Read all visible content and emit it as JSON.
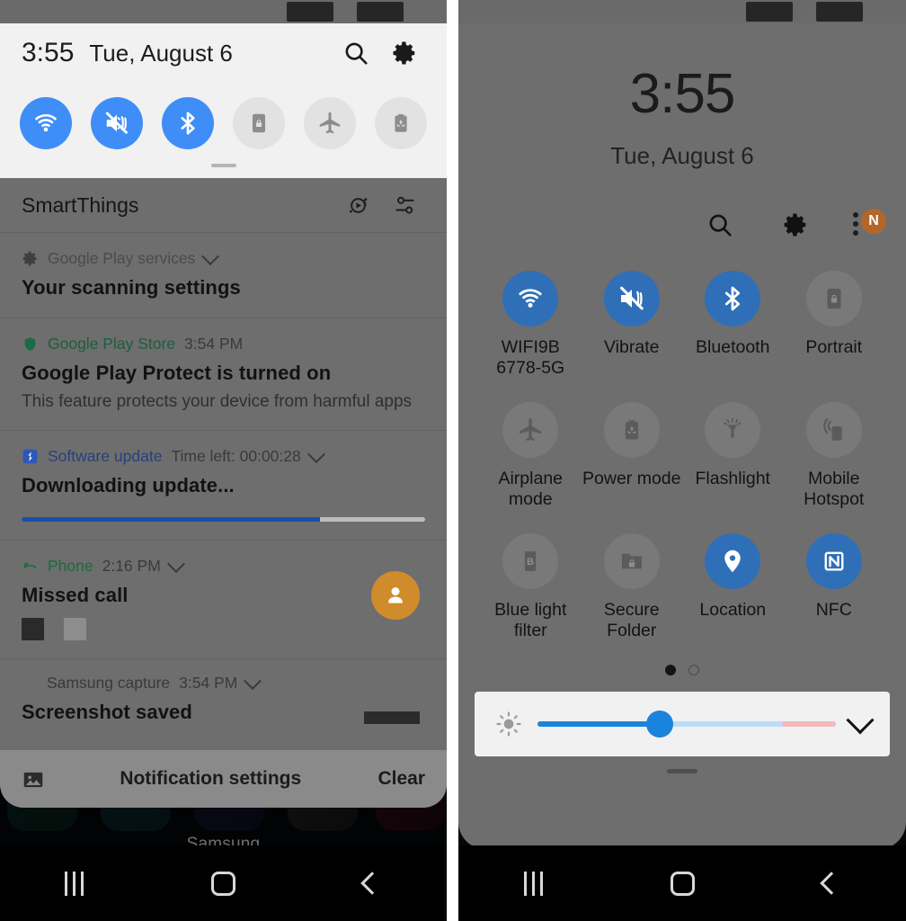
{
  "left_panel": {
    "statusbar": {
      "redacted_items": 2
    },
    "quick_panel": {
      "time": "3:55",
      "date": "Tue, August 6",
      "search_icon": "search-icon",
      "settings_icon": "gear-icon",
      "tiles": [
        {
          "name": "wifi-tile",
          "icon": "wifi-icon",
          "state": "on"
        },
        {
          "name": "vibrate-tile",
          "icon": "mute-vibrate-icon",
          "state": "on"
        },
        {
          "name": "bluetooth-tile",
          "icon": "bluetooth-icon",
          "state": "on"
        },
        {
          "name": "portrait-tile",
          "icon": "auto-rotate-lock-icon",
          "state": "off"
        },
        {
          "name": "airplane-mode-tile",
          "icon": "airplane-icon",
          "state": "off"
        },
        {
          "name": "power-mode-tile",
          "icon": "battery-recycle-icon",
          "state": "off"
        }
      ]
    },
    "notifications_header": {
      "title": "SmartThings",
      "icons": [
        "smartthings-scene-icon",
        "notification-filter-icon"
      ]
    },
    "notifications": [
      {
        "app": "Google Play services",
        "app_color": "#4b4b4b",
        "time": "",
        "title": "Your scanning settings",
        "body": "",
        "icon": "gear-icon",
        "has_chevron": true,
        "progress": null
      },
      {
        "app": "Google Play Store",
        "app_color": "#1b5e3f",
        "time": "3:54 PM",
        "title": "Google Play Protect is turned on",
        "body": "This feature protects your device from harmful apps",
        "icon": "shield-icon",
        "has_chevron": false,
        "progress": null
      },
      {
        "app": "Software update",
        "app_color": "#27407e",
        "time": "Time left: 00:00:28",
        "title": "Downloading update...",
        "body": "",
        "icon": "software-update-icon",
        "has_chevron": true,
        "progress": 74
      },
      {
        "app": "Phone",
        "app_color": "#1b6b3a",
        "time": "2:16 PM",
        "title": "Missed call",
        "body": "",
        "icon": "missed-call-icon",
        "has_chevron": true,
        "progress": null,
        "has_avatar": true,
        "redacted_blocks": 2
      },
      {
        "app": "Samsung capture",
        "app_color": "#3a3a3a",
        "time": "3:54 PM",
        "title": "Screenshot saved",
        "body": "",
        "icon": "capture-icon",
        "has_chevron": true,
        "progress": null
      }
    ],
    "footer": {
      "image_icon": "picture-icon",
      "settings_label": "Notification settings",
      "clear_label": "Clear"
    },
    "home_screen": {
      "folder_label": "Samsung"
    },
    "navbar": {
      "recents": "recents-icon",
      "home": "home-icon",
      "back": "back-icon"
    }
  },
  "right_panel": {
    "statusbar": {
      "redacted_items": 2
    },
    "clock": "3:55",
    "date": "Tue, August 6",
    "toolbar": {
      "search_icon": "search-icon",
      "settings_icon": "gear-icon",
      "more_icon": "more-options-icon",
      "badge_letter": "N"
    },
    "tiles": [
      {
        "name": "wifi-tile",
        "icon": "wifi-icon",
        "label": "WIFI9B 6778-5G",
        "state": "on"
      },
      {
        "name": "vibrate-tile",
        "icon": "mute-vibrate-icon",
        "label": "Vibrate",
        "state": "on"
      },
      {
        "name": "bluetooth-tile",
        "icon": "bluetooth-icon",
        "label": "Bluetooth",
        "state": "on"
      },
      {
        "name": "portrait-tile",
        "icon": "auto-rotate-lock-icon",
        "label": "Portrait",
        "state": "off"
      },
      {
        "name": "airplane-mode-tile",
        "icon": "airplane-icon",
        "label": "Airplane mode",
        "state": "off"
      },
      {
        "name": "power-mode-tile",
        "icon": "battery-recycle-icon",
        "label": "Power mode",
        "state": "off"
      },
      {
        "name": "flashlight-tile",
        "icon": "flashlight-icon",
        "label": "Flashlight",
        "state": "off"
      },
      {
        "name": "mobile-hotspot-tile",
        "icon": "hotspot-icon",
        "label": "Mobile Hotspot",
        "state": "off"
      },
      {
        "name": "blue-light-filter-tile",
        "icon": "blue-light-icon",
        "label": "Blue light filter",
        "state": "off"
      },
      {
        "name": "secure-folder-tile",
        "icon": "secure-folder-icon",
        "label": "Secure Folder",
        "state": "off"
      },
      {
        "name": "location-tile",
        "icon": "location-pin-icon",
        "label": "Location",
        "state": "on"
      },
      {
        "name": "nfc-tile",
        "icon": "nfc-icon",
        "label": "NFC",
        "state": "on"
      }
    ],
    "pager": {
      "pages": 2,
      "active": 1
    },
    "brightness": {
      "icon": "brightness-sun-icon",
      "value_percent": 41,
      "expand_icon": "chevron-down-icon"
    },
    "navbar": {
      "recents": "recents-icon",
      "home": "home-icon",
      "back": "back-icon"
    }
  },
  "colors": {
    "accent_blue_light": "#3f8ef7",
    "accent_blue_dark": "#2f6fb8",
    "panel_gray": "#6e6e6e",
    "panel_light": "#f1f1f1",
    "progress_blue": "#1b4fa8",
    "avatar_orange": "#d08c2c",
    "badge_orange": "#b3662a"
  }
}
